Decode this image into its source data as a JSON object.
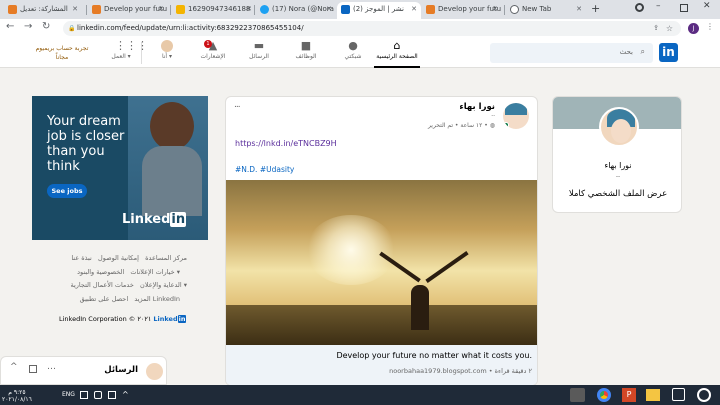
{
  "browser": {
    "tabs": [
      {
        "title": "المشاركة: تعديل",
        "color": "#e67c26"
      },
      {
        "title": "Develop your futu",
        "color": "#e67c26"
      },
      {
        "title": "16290947346188",
        "color": "#f4b400"
      },
      {
        "title": "(17) Nora (@Nora",
        "color": "#1da1f2"
      },
      {
        "title": "(2) نشر | الموجز",
        "color": "#0a66c2"
      },
      {
        "title": "Develop your futu",
        "color": "#e67c26"
      },
      {
        "title": "New Tab",
        "color": "#5f6368"
      }
    ],
    "url": "linkedin.com/feed/update/urn:li:activity:6832922370865455104/",
    "profile_initial": "J"
  },
  "header": {
    "search_placeholder": "بحث",
    "nav": {
      "home": "الصفحة الرئيسية",
      "network": "شبكتي",
      "jobs": "الوظائف",
      "messaging": "الرسائل",
      "notifications": "الإشعارات",
      "me": "أنا",
      "work": "العمل"
    },
    "notif_count": "1",
    "premium_line1": "تجربة حساب بريميوم",
    "premium_line2": "مجاناً"
  },
  "profile_card": {
    "name": "نورا بهاء",
    "dots": "--",
    "view_profile": "عرض الملف الشخصي كاملا"
  },
  "post": {
    "author": "نورا بهاء",
    "author_sub": "--",
    "meta": "١٢ ساعة • تم التحرير •",
    "link": "https://lnkd.in/eTNCBZ9H",
    "hashtags": "#N.D. #Udasity",
    "preview_title": "Develop your future no matter what it costs you.",
    "preview_source": "noorbahaa1979.blogspot.com • ٢ دقيقة قراءة",
    "more": "..."
  },
  "ad": {
    "line1": "Your dream",
    "line2": "job is closer",
    "line3": "than you",
    "line4": "think",
    "button": "See jobs",
    "brand": "Linked",
    "brand_in": "in"
  },
  "footer": {
    "links_row1": [
      "نبذة عنا",
      "إمكانية الوصول",
      "مركز المساعدة"
    ],
    "links_row2": [
      "الخصوصية والبنود",
      "خيارات الإعلانات"
    ],
    "links_row3": [
      "الدعاية والإعلان",
      "خدمات الأعمال التجارية"
    ],
    "links_row4": [
      "احصل على تطبيق LinkedIn",
      "المزيد"
    ],
    "copyright": "LinkedIn Corporation © ٢٠٢١",
    "brand": "Linked",
    "brand_in": "in"
  },
  "messaging_bar": {
    "label": "الرسائل"
  },
  "taskbar": {
    "time": "٩:٢٥ م",
    "date": "٢٠٢١/٠٨/١٦",
    "lang": "ENG"
  }
}
